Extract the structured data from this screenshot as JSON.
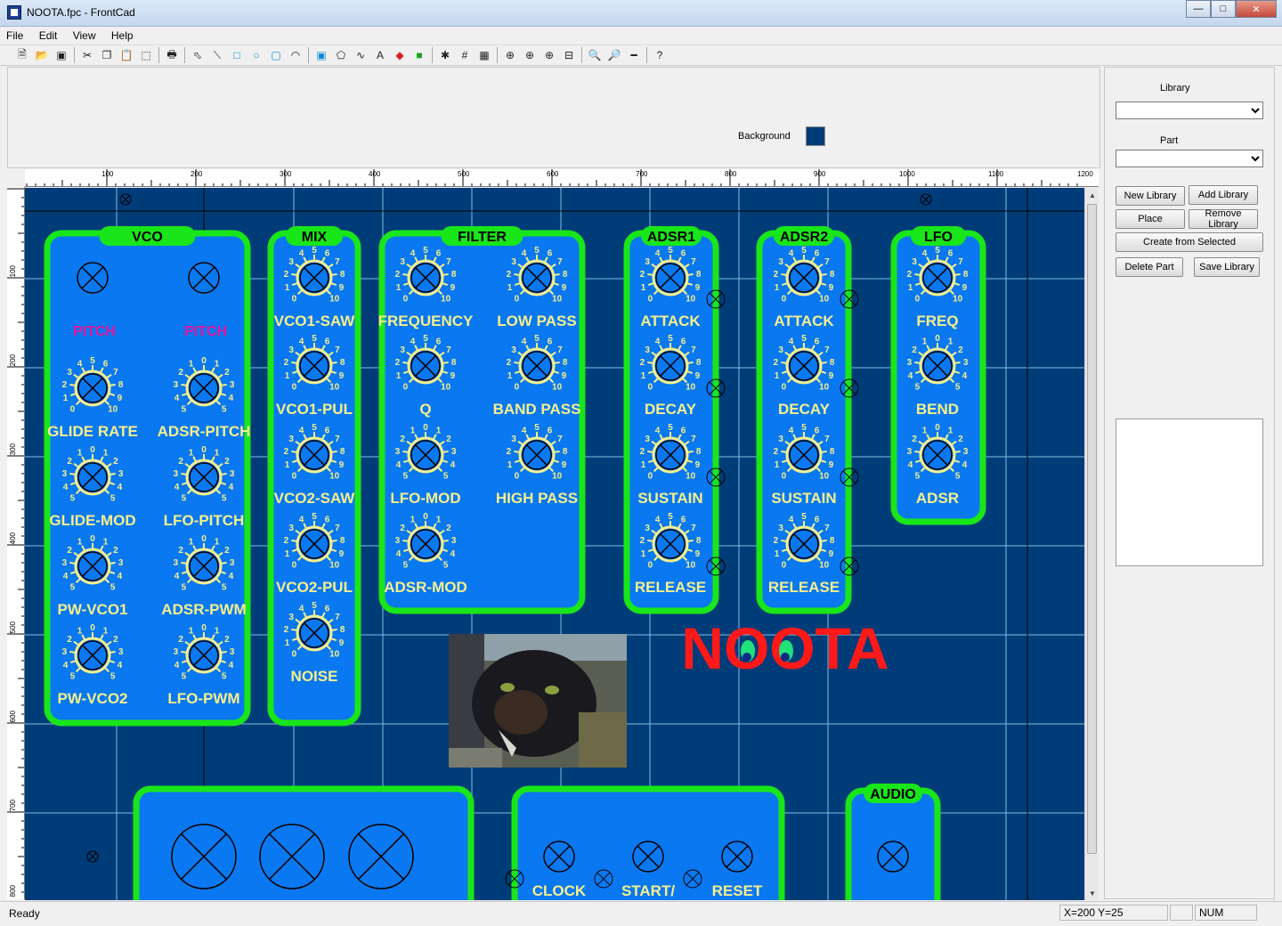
{
  "window": {
    "title": "NOOTA.fpc - FrontCad"
  },
  "menu": [
    "File",
    "Edit",
    "View",
    "Help"
  ],
  "toolbar_icons": [
    "new-file-icon",
    "open-folder-icon",
    "save-icon",
    "cut-icon",
    "copy-icon",
    "paste-icon",
    "select-area-icon",
    "print-icon",
    "pointer-icon",
    "line-icon",
    "rectangle-icon",
    "circle-icon",
    "rounded-rect-icon",
    "arc-icon",
    "round-button-icon",
    "polygon-icon",
    "curve-icon",
    "text-icon",
    "fill-icon",
    "image-icon",
    "snap-icon",
    "grid-icon",
    "grid-set-icon",
    "zoom-fit-icon",
    "zoom-in-plus-icon",
    "zoom-sheet-icon",
    "zoom-window-icon",
    "zoom-in-icon",
    "zoom-out-icon",
    "measure-icon",
    "help-icon"
  ],
  "properties": {
    "background_label": "Background",
    "background_color": "#003c78"
  },
  "ruler": {
    "h_labels": [
      "100",
      "200",
      "300",
      "400",
      "500",
      "600",
      "700",
      "800",
      "900",
      "1000",
      "1100",
      "1200"
    ],
    "v_labels": [
      "100",
      "200",
      "300",
      "400",
      "500",
      "600",
      "700",
      "800"
    ]
  },
  "panel": {
    "library_label": "Library",
    "part_label": "Part",
    "new_library": "New Library",
    "add_library": "Add Library",
    "place": "Place",
    "remove_library": "Remove Library",
    "create_from_selected": "Create from Selected",
    "delete_part": "Delete Part",
    "save_library": "Save Library"
  },
  "design": {
    "colors": {
      "panel_fill": "#0a78f0",
      "panel_border": "#19e619",
      "text_yellow": "#f5f08c",
      "pitch_magenta": "#e6149b",
      "logo_red": "#ff1919"
    },
    "modules": [
      {
        "key": "vco",
        "title": "VCO"
      },
      {
        "key": "mix",
        "title": "MIX"
      },
      {
        "key": "filter",
        "title": "FILTER"
      },
      {
        "key": "adsr1",
        "title": "ADSR1"
      },
      {
        "key": "adsr2",
        "title": "ADSR2"
      },
      {
        "key": "lfo",
        "title": "LFO"
      },
      {
        "key": "audio",
        "title": "AUDIO"
      }
    ],
    "pitch_labels": [
      "PITCH",
      "PITCH"
    ],
    "vco_knobs": [
      "GLIDE RATE",
      "ADSR-PITCH",
      "GLIDE-MOD",
      "LFO-PITCH",
      "PW-VCO1",
      "ADSR-PWM",
      "PW-VCO2",
      "LFO-PWM"
    ],
    "mix_knobs": [
      "VCO1-SAW",
      "VCO1-PUL",
      "VCO2-SAW",
      "VCO2-PUL",
      "NOISE"
    ],
    "filter_knobs": [
      "FREQUENCY",
      "LOW PASS",
      "Q",
      "BAND PASS",
      "LFO-MOD",
      "HIGH PASS",
      "ADSR-MOD"
    ],
    "adsr1_knobs": [
      "ATTACK",
      "DECAY",
      "SUSTAIN",
      "RELEASE"
    ],
    "adsr2_knobs": [
      "ATTACK",
      "DECAY",
      "SUSTAIN",
      "RELEASE"
    ],
    "lfo_knobs": [
      "FREQ",
      "BEND",
      "ADSR"
    ],
    "clock_labels": [
      "CLOCK",
      "START/",
      "RESET"
    ],
    "logo": "NOOTA"
  },
  "status": {
    "ready": "Ready",
    "coords": "X=200 Y=25",
    "num": "NUM"
  }
}
